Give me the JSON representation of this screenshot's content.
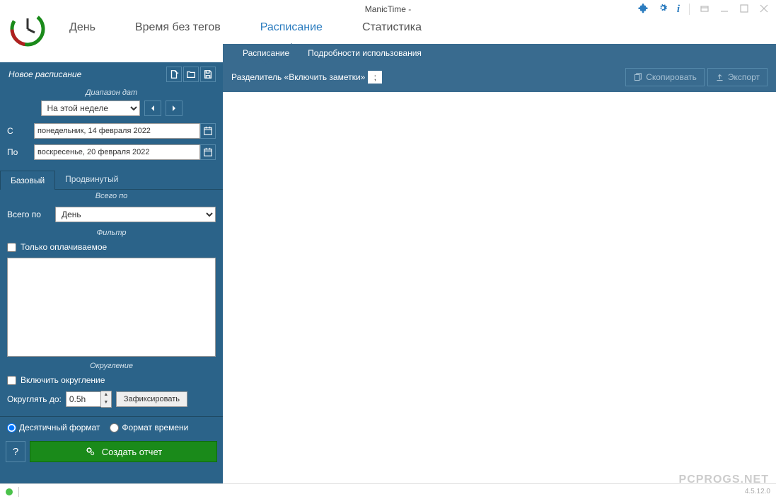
{
  "window": {
    "title": "ManicTime -",
    "version": "4.5.12.0",
    "watermark": "PCPROGS.NET"
  },
  "topnav": {
    "items": [
      "День",
      "Время без тегов",
      "Расписание",
      "Статистика"
    ],
    "active_index": 2
  },
  "subnav": {
    "items": [
      "Расписание",
      "Подробности использования"
    ],
    "active_index": 0
  },
  "sidebar": {
    "header_title": "Новое расписание",
    "date_range_label": "Диапазон дат",
    "range_preset": "На этой неделе",
    "from_label": "С",
    "to_label": "По",
    "from_date": "понедельник, 14 февраля 2022",
    "to_date": "воскресенье, 20 февраля 2022",
    "subtabs": [
      "Базовый",
      "Продвинутый"
    ],
    "subtab_active_index": 0,
    "totals_section_label": "Всего по",
    "totals_label": "Всего по",
    "totals_value": "День",
    "filter_label": "Фильтр",
    "billable_only_label": "Только оплачиваемое",
    "rounding_label": "Округление",
    "enable_rounding_label": "Включить округление",
    "round_to_label": "Округлять до:",
    "round_value": "0.5h",
    "fix_button": "Зафиксировать",
    "format_decimal": "Десятичный формат",
    "format_time": "Формат времени",
    "create_report": "Создать отчет"
  },
  "content": {
    "separator_label": "Разделитель «Включить заметки»",
    "separator_value": ";",
    "copy_label": "Скопировать",
    "export_label": "Экспорт"
  }
}
